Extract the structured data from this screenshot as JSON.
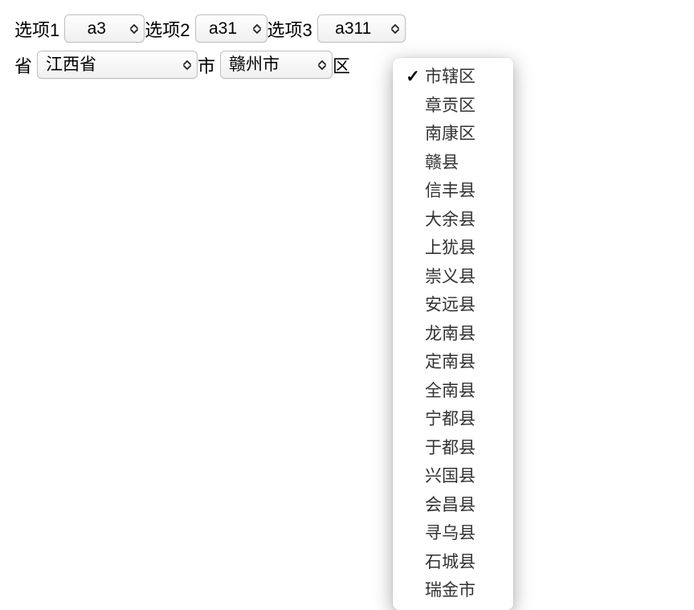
{
  "row1": {
    "option1": {
      "label": "选项1",
      "value": "a3"
    },
    "option2": {
      "label": "选项2",
      "value": "a31"
    },
    "option3": {
      "label": "选项3",
      "value": "a311"
    }
  },
  "row2": {
    "province": {
      "label": "省",
      "value": "江西省"
    },
    "city": {
      "label": "市",
      "value": "赣州市"
    },
    "district": {
      "label": "区"
    }
  },
  "dropdown": {
    "selected_index": 0,
    "items": [
      "市辖区",
      "章贡区",
      "南康区",
      "赣县",
      "信丰县",
      "大余县",
      "上犹县",
      "崇义县",
      "安远县",
      "龙南县",
      "定南县",
      "全南县",
      "宁都县",
      "于都县",
      "兴国县",
      "会昌县",
      "寻乌县",
      "石城县",
      "瑞金市"
    ]
  }
}
